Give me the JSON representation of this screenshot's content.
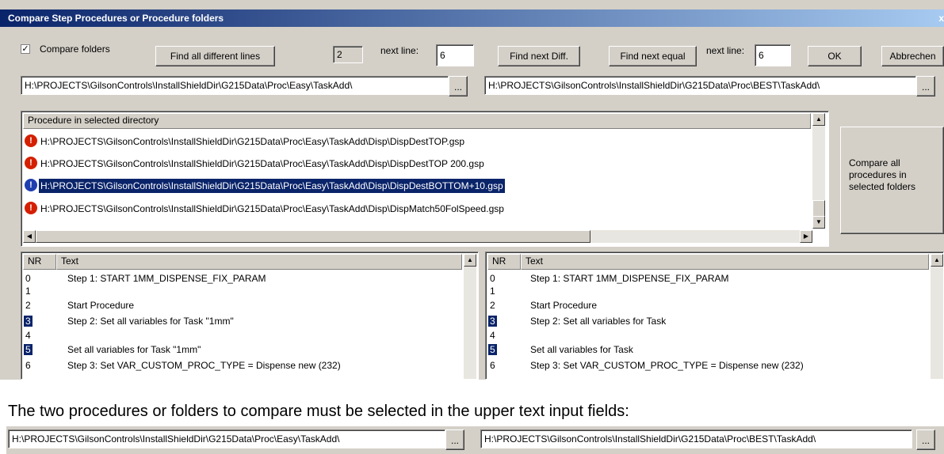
{
  "window": {
    "title": "Compare Step Procedures or Procedure folders",
    "close": "x"
  },
  "toolbar": {
    "compare_folders_checked": true,
    "compare_folders_label": "Compare folders",
    "find_all_label": "Find all different lines",
    "diff_count": "2",
    "next_line_label_left": "next line:",
    "next_line_left_value": "6",
    "find_next_diff_label": "Find next Diff.",
    "find_next_equal_label": "Find next equal",
    "next_line_label_right": "next line:",
    "next_line_right_value": "6",
    "ok_label": "OK",
    "cancel_label": "Abbrechen"
  },
  "paths": {
    "left": "H:\\PROJECTS\\GilsonControls\\InstallShieldDir\\G215Data\\Proc\\Easy\\TaskAdd\\",
    "right": "H:\\PROJECTS\\GilsonControls\\InstallShieldDir\\G215Data\\Proc\\BEST\\TaskAdd\\",
    "browse_label": "..."
  },
  "procedures": {
    "header": "Procedure in selected directory",
    "items": [
      {
        "icon": "!",
        "status": "different",
        "path": "H:\\PROJECTS\\GilsonControls\\InstallShieldDir\\G215Data\\Proc\\Easy\\TaskAdd\\Disp\\DispDestTOP.gsp"
      },
      {
        "icon": "!",
        "status": "different",
        "path": "H:\\PROJECTS\\GilsonControls\\InstallShieldDir\\G215Data\\Proc\\Easy\\TaskAdd\\Disp\\DispDestTOP 200.gsp"
      },
      {
        "icon": "!",
        "status": "selected",
        "path": "H:\\PROJECTS\\GilsonControls\\InstallShieldDir\\G215Data\\Proc\\Easy\\TaskAdd\\Disp\\DispDestBOTTOM+10.gsp"
      },
      {
        "icon": "!",
        "status": "different",
        "path": "H:\\PROJECTS\\GilsonControls\\InstallShieldDir\\G215Data\\Proc\\Easy\\TaskAdd\\Disp\\DispMatch50FolSpeed.gsp"
      }
    ],
    "compare_all_label": "Compare all procedures in selected folders"
  },
  "left_view": {
    "col_nr": "NR",
    "col_text": "Text",
    "rows": [
      {
        "nr": "0",
        "text": "Step 1: START 1MM_DISPENSE_FIX_PARAM",
        "hl": false
      },
      {
        "nr": "1",
        "text": "",
        "hl": false
      },
      {
        "nr": "2",
        "text": "Start Procedure",
        "hl": false
      },
      {
        "nr": "3",
        "text": "Step 2: Set all variables for Task \"1mm\"",
        "hl": true
      },
      {
        "nr": "4",
        "text": "",
        "hl": false
      },
      {
        "nr": "5",
        "text": "Set all variables for Task \"1mm\"",
        "hl": true
      },
      {
        "nr": "6",
        "text": "Step 3: Set VAR_CUSTOM_PROC_TYPE = Dispense new (232)",
        "hl": false
      }
    ]
  },
  "right_view": {
    "col_nr": "NR",
    "col_text": "Text",
    "rows": [
      {
        "nr": "0",
        "text": "Step 1: START 1MM_DISPENSE_FIX_PARAM",
        "hl": false
      },
      {
        "nr": "1",
        "text": "",
        "hl": false
      },
      {
        "nr": "2",
        "text": "Start Procedure",
        "hl": false
      },
      {
        "nr": "3",
        "text": "Step 2: Set all variables for Task",
        "hl": true
      },
      {
        "nr": "4",
        "text": "",
        "hl": false
      },
      {
        "nr": "5",
        "text": "Set all variables for Task",
        "hl": true
      },
      {
        "nr": "6",
        "text": "Step 3: Set VAR_CUSTOM_PROC_TYPE = Dispense new (232)",
        "hl": false
      }
    ]
  },
  "caption": "The two procedures or folders to compare must be selected in the upper text input fields:",
  "colors": {
    "title_start": "#0a246a",
    "title_end": "#a6caf0",
    "selection": "#0a246a",
    "error_icon": "#d42000",
    "info_icon": "#1f3fb0",
    "face": "#d4d0c8"
  }
}
